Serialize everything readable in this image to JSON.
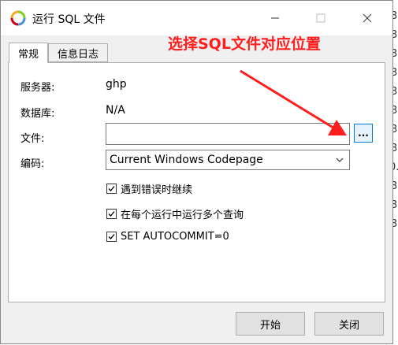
{
  "window": {
    "title": "运行 SQL 文件",
    "controls": {
      "minimize": "minimize",
      "maximize": "maximize",
      "close": "close"
    }
  },
  "tabs": [
    {
      "label": "常规",
      "active": true
    },
    {
      "label": "信息日志",
      "active": false
    }
  ],
  "form": {
    "server_label": "服务器:",
    "server_value": "ghp",
    "database_label": "数据库:",
    "database_value": "N/A",
    "file_label": "文件:",
    "file_value": "",
    "browse_label": "...",
    "encoding_label": "编码:",
    "encoding_value": "Current Windows Codepage"
  },
  "options": [
    {
      "label": "遇到错误时继续",
      "checked": true
    },
    {
      "label": "在每个运行中运行多个查询",
      "checked": true
    },
    {
      "label": "SET AUTOCOMMIT=0",
      "checked": true
    }
  ],
  "buttons": {
    "start": "开始",
    "close": "关闭"
  },
  "annotation": {
    "text": "选择SQL文件对应位置",
    "color": "#ff1e1e"
  },
  "background": {
    "right_edge_digits": [
      "3",
      "3",
      "3",
      "3",
      "3",
      "3",
      "3",
      "3",
      "0.",
      "3",
      "3",
      "3"
    ]
  },
  "colors": {
    "accent": "#0078d7",
    "annotation": "#ff1e1e"
  }
}
